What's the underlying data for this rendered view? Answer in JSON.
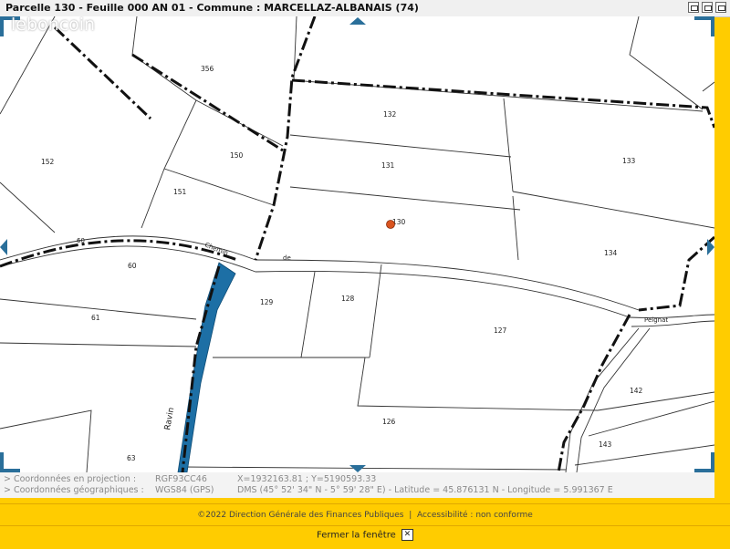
{
  "window": {
    "title": "Parcelle 130 - Feuille 000 AN 01 - Commune : MARCELLAZ-ALBANAIS (74)"
  },
  "watermark": "leboncoin",
  "map": {
    "parcels": [
      "356",
      "132",
      "152",
      "150",
      "131",
      "133",
      "151",
      "130",
      "134",
      "60",
      "129",
      "128",
      "61",
      "127",
      "126",
      "142",
      "143",
      "63"
    ],
    "roads": [
      "60",
      "Chemin",
      "de",
      "Peignat",
      "Ravin"
    ],
    "marker_color": "#d9541f",
    "river_color": "#1d6fa5",
    "nav_color": "#2a6f9a"
  },
  "coords": {
    "projection_label": "> Coordonnées en projection :",
    "projection_system": "RGF93CC46",
    "projection_value": "X=1932163.81 ; Y=5190593.33",
    "geographic_label": "> Coordonnées géographiques :",
    "geographic_system": "WGS84 (GPS)",
    "geographic_value": "DMS (45° 52' 34\" N - 5° 59' 28\" E) - Latitude = 45.876131 N - Longitude = 5.991367 E"
  },
  "footer": {
    "copyright": "©2022 Direction Générale des Finances Publiques",
    "separator": "|",
    "accessibility": "Accessibilité : non conforme"
  },
  "close": {
    "label": "Fermer la fenêtre",
    "icon": "✕"
  }
}
